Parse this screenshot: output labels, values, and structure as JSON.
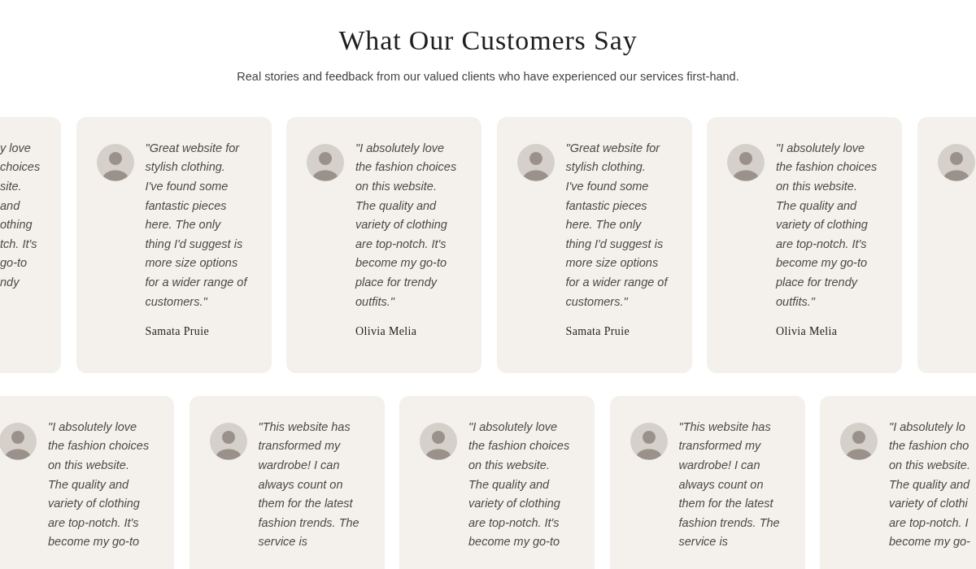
{
  "header": {
    "title": "What Our Customers Say",
    "subtitle": "Real stories and feedback from our valued clients who have experienced our services first-hand."
  },
  "rows": [
    {
      "cards": [
        {
          "kind": "left_edge",
          "lines": [
            "y love",
            "choices",
            "site.",
            "and",
            "othing",
            "tch. It's",
            "go-to",
            "ndy"
          ]
        },
        {
          "kind": "full",
          "lines": [
            "\"Great website for",
            "stylish clothing.",
            "I've found some",
            "fantastic pieces",
            "here. The only",
            "thing I'd suggest is",
            "more size options",
            "for a wider range of",
            "customers.\""
          ],
          "name": "Samata Pruie"
        },
        {
          "kind": "full",
          "lines": [
            "\"I absolutely love",
            "the fashion choices",
            "on this website.",
            "The quality and",
            "variety of clothing",
            "are top-notch. It's",
            "become my go-to",
            "place for trendy",
            "outfits.\""
          ],
          "name": "Olivia Melia"
        },
        {
          "kind": "full",
          "lines": [
            "\"Great website for",
            "stylish clothing.",
            "I've found some",
            "fantastic pieces",
            "here. The only",
            "thing I'd suggest is",
            "more size options",
            "for a wider range of",
            "customers.\""
          ],
          "name": "Samata Pruie"
        },
        {
          "kind": "full",
          "lines": [
            "\"I absolutely love",
            "the fashion choices",
            "on this website.",
            "The quality and",
            "variety of clothing",
            "are top-notch. It's",
            "become my go-to",
            "place for trendy",
            "outfits.\""
          ],
          "name": "Olivia Melia"
        },
        {
          "kind": "right_edge"
        }
      ]
    },
    {
      "cards": [
        {
          "kind": "full",
          "lines": [
            "\"I absolutely love",
            "the fashion choices",
            "on this website.",
            "The quality and",
            "variety of clothing",
            "are top-notch. It's",
            "become my go-to"
          ]
        },
        {
          "kind": "full",
          "lines": [
            "\"This website has",
            "transformed my",
            "wardrobe! I can",
            "always count on",
            "them for the latest",
            "fashion trends. The",
            "service is"
          ]
        },
        {
          "kind": "full",
          "lines": [
            "\"I absolutely love",
            "the fashion choices",
            "on this website.",
            "The quality and",
            "variety of clothing",
            "are top-notch. It's",
            "become my go-to"
          ]
        },
        {
          "kind": "full",
          "lines": [
            "\"This website has",
            "transformed my",
            "wardrobe! I can",
            "always count on",
            "them for the latest",
            "fashion trends. The",
            "service is"
          ]
        },
        {
          "kind": "right_edge",
          "lines": [
            "\"I absolutely lo",
            "the fashion cho",
            "on this website.",
            "The quality and",
            "variety of clothi",
            "are top-notch. I",
            "become my go-"
          ]
        }
      ]
    }
  ]
}
